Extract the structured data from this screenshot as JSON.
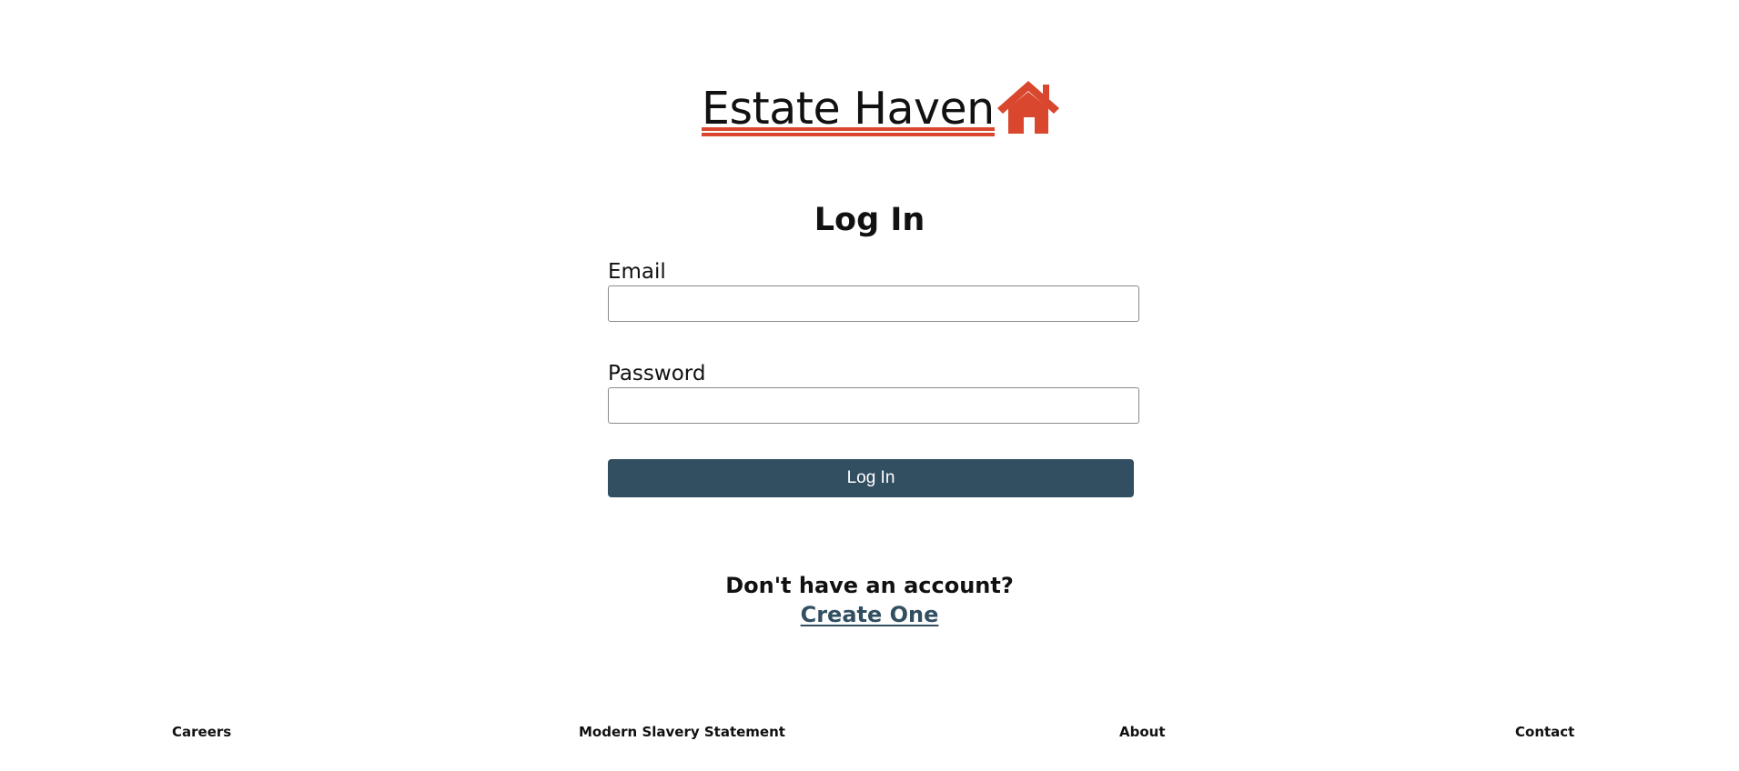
{
  "brand": {
    "name": "Estate Haven",
    "accent_color": "#d9472e",
    "icon": "house-icon"
  },
  "page": {
    "title": "Log In"
  },
  "form": {
    "email": {
      "label": "Email",
      "value": "",
      "placeholder": ""
    },
    "password": {
      "label": "Password",
      "value": "",
      "placeholder": ""
    },
    "submit_label": "Log In",
    "button_color": "#324f62"
  },
  "signup": {
    "question": "Don't have an account?",
    "link_label": "Create One"
  },
  "footer": {
    "links": [
      {
        "label": "Careers"
      },
      {
        "label": "Modern Slavery Statement"
      },
      {
        "label": "About"
      },
      {
        "label": "Contact"
      }
    ]
  }
}
